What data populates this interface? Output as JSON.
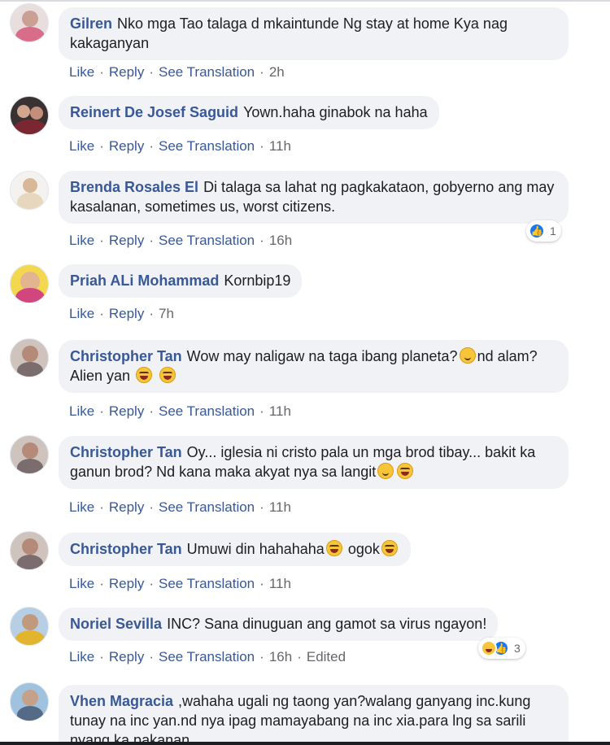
{
  "actions": {
    "like": "Like",
    "reply": "Reply",
    "see_translation": "See Translation",
    "separator": "·"
  },
  "comments": [
    {
      "author": "Gilren",
      "text": "Nko mga Tao talaga d mkaintunde Ng stay at home Kya nag kakaganyan",
      "time": "2h"
    },
    {
      "author": "Reinert De Josef Saguid",
      "text": "Yown.haha ginabok na haha",
      "time": "11h"
    },
    {
      "author": "Brenda Rosales El",
      "text": "Di talaga sa lahat ng pagkakataon, gobyerno ang may kasalanan, sometimes us, worst citizens.",
      "time": "16h",
      "reaction_count": "1"
    },
    {
      "author": "Priah ALi Mohammad",
      "text": "Kornbip19",
      "time": "7h"
    },
    {
      "author": "Christopher Tan",
      "text_parts": [
        "Wow may naligaw na taga ibang planeta?",
        "nd alam? Alien yan "
      ],
      "time": "11h"
    },
    {
      "author": "Christopher Tan",
      "text": "Oy... iglesia ni cristo pala un mga brod tibay... bakit ka ganun brod? Nd kana maka akyat nya sa langit",
      "time": "11h"
    },
    {
      "author": "Christopher Tan",
      "text_parts": [
        "Umuwi din hahahaha",
        "ogok"
      ],
      "time": "11h"
    },
    {
      "author": "Noriel Sevilla",
      "text": "INC? Sana dinuguan ang gamot sa virus ngayon!",
      "time": "16h",
      "edited": "Edited",
      "reaction_count": "3"
    },
    {
      "author": "Vhen Magracia",
      "text": ",wahaha ugali ng taong yan?walang ganyang inc.kung tunay na inc yan.nd nya ipag mamayabang na inc xia.para lng sa sarili nyang ka pakanan"
    }
  ],
  "colors": {
    "author": "#385898",
    "bubble": "#f0f2f5",
    "meta": "#65676b",
    "like_blue": "#1877f2"
  }
}
